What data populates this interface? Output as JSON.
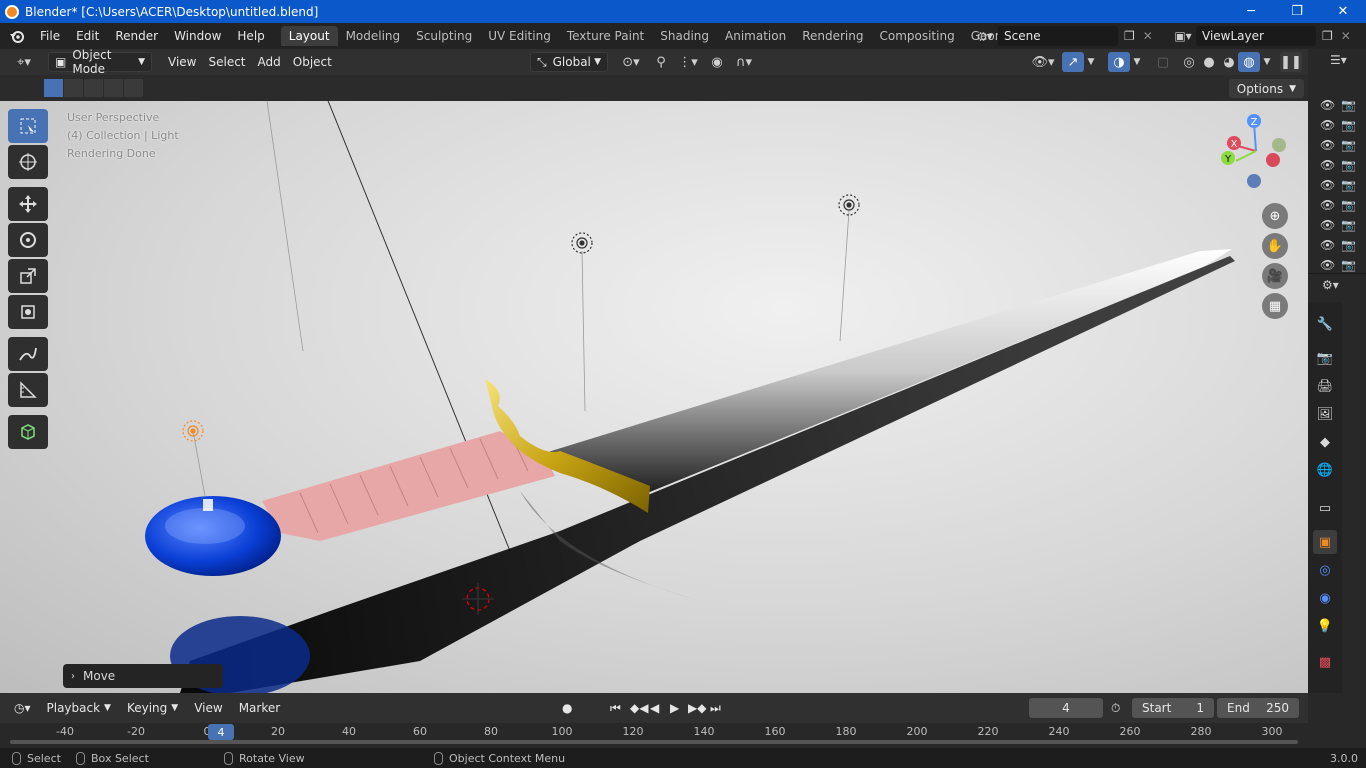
{
  "window": {
    "title": "Blender* [C:\\Users\\ACER\\Desktop\\untitled.blend]",
    "minimize": "─",
    "maximize": "❐",
    "close": "✕"
  },
  "menu": {
    "items": [
      "File",
      "Edit",
      "Render",
      "Window",
      "Help"
    ]
  },
  "workspaces": {
    "tabs": [
      "Layout",
      "Modeling",
      "Sculpting",
      "UV Editing",
      "Texture Paint",
      "Shading",
      "Animation",
      "Rendering",
      "Compositing",
      "Geometry Nod"
    ],
    "active": "Layout"
  },
  "scene": {
    "name": "Scene",
    "view_layer": "ViewLayer"
  },
  "viewport_header": {
    "mode": "Object Mode",
    "menus": [
      "View",
      "Select",
      "Add",
      "Object"
    ],
    "orientation": "Global",
    "options_label": "Options"
  },
  "viewport": {
    "overlay_lines": [
      "User Perspective",
      "(4) Collection | Light",
      "Rendering Done"
    ],
    "gizmo_axes": {
      "x": "X",
      "y": "Y",
      "z": "Z"
    },
    "last_op": "Move"
  },
  "timeline": {
    "menus": [
      "Playback",
      "Keying",
      "View",
      "Marker"
    ],
    "current_frame": "4",
    "start_label": "Start",
    "start": "1",
    "end_label": "End",
    "end": "250",
    "ticks": [
      "-40",
      "-20",
      "0",
      "20",
      "40",
      "60",
      "80",
      "100",
      "120",
      "140",
      "160",
      "180",
      "200",
      "220",
      "240",
      "260",
      "280",
      "300"
    ],
    "current_marker": "4"
  },
  "statusbar": {
    "select": "Select",
    "box_select": "Box Select",
    "rotate_view": "Rotate View",
    "context_menu": "Object Context Menu",
    "version": "3.0.0"
  },
  "colors": {
    "accent": "#4772b3",
    "titlebar": "#0a58ca",
    "grip": "#e8a7a7",
    "guard": "#d4b01e",
    "pommel": "#0a3fd6"
  }
}
